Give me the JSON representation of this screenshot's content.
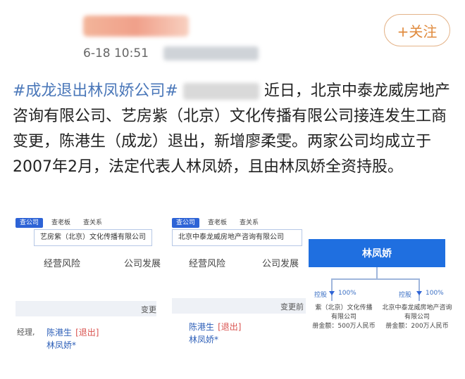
{
  "header": {
    "time": "6-18 10:51",
    "follow_label": "+关注"
  },
  "post": {
    "hashtag": "#成龙退出林凤娇公司#",
    "text": "近日，北京中泰龙威房地产咨询有限公司、艺房紫（北京）文化传播有限公司接连发生工商变更，陈港生（成龙）退出，新增廖柔雯。两家公司均成立于2007年2月，法定代表人林凤娇，且由林凤娇全资持股。"
  },
  "panel1": {
    "tab_active": "查公司",
    "tabs": [
      "查老板",
      "查关系"
    ],
    "company": "艺房紫（北京）文化传播有限公司",
    "nav_left": "经营风险",
    "nav_right": "公司发展",
    "change_header": "变更",
    "row_label": "经理,",
    "person1": "陈港生",
    "exit_tag": "[退出]",
    "person2": "林凤娇*"
  },
  "panel2": {
    "tab_active": "查公司",
    "tabs": [
      "查老板",
      "查关系"
    ],
    "company": "北京中泰龙威房地产咨询有限公司",
    "nav_left": "经营风险",
    "nav_right": "公司发展",
    "change_header": "变更前",
    "person1": "陈港生",
    "exit_tag": "[退出]",
    "person2": "林凤娇*"
  },
  "panel3": {
    "owner": "林凤娇",
    "left_rel": "控股",
    "left_pct": "100%",
    "right_rel": "控股",
    "right_pct": "100%",
    "left_company": "紫（北京）文化传播",
    "left_company2": "有限公司",
    "left_capital": "册金额：500万人民币",
    "right_company": "北京中泰龙威房地产咨询",
    "right_company2": "有限公司",
    "right_capital": "册金额：200万人民币"
  }
}
